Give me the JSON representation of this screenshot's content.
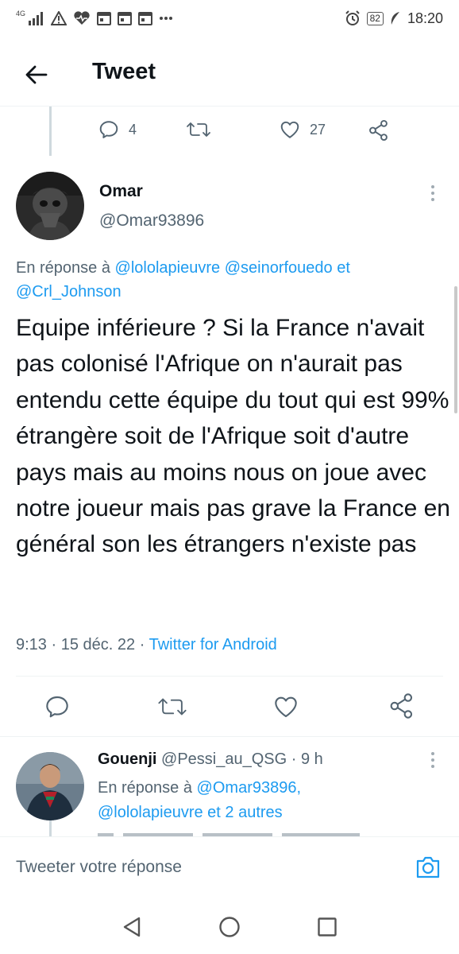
{
  "status_bar": {
    "network": "4G",
    "battery": "82",
    "time": "18:20"
  },
  "header": {
    "title": "Tweet"
  },
  "previous_tweet_actions": {
    "reply_count": "4",
    "retweet_count": "",
    "like_count": "27"
  },
  "main_tweet": {
    "author_name": "Omar",
    "author_handle": "@Omar93896",
    "reply_prefix": "En réponse à",
    "mention_1": "@lololapieuvre",
    "mention_2": "@seinorfouedo",
    "mention_conj": "et",
    "mention_3": "@Crl_Johnson",
    "text": "Equipe inférieure ? Si la France n'avait pas colonisé l'Afrique on n'aurait pas entendu cette équipe du tout qui est 99% étrangère soit de l'Afrique soit d'autre pays mais au moins nous on joue avec notre joueur mais pas grave la France en général son les étrangers n'existe pas",
    "time": "9:13",
    "sep1": "·",
    "date": "15 déc. 22",
    "sep2": "·",
    "source": "Twitter for Android"
  },
  "reply_tweet": {
    "author_name": "Gouenji",
    "author_handle": "@Pessi_au_QSG",
    "sep": "·",
    "age": "9 h",
    "reply_prefix": "En réponse à",
    "mention_1": "@Omar93896,",
    "mention_2": "@lololapieuvre",
    "tail": "et 2 autres"
  },
  "composer": {
    "placeholder": "Tweeter votre réponse"
  },
  "colors": {
    "accent": "#1d9bf0",
    "text": "#0f1419",
    "secondary": "#536471",
    "divider": "#eff3f4"
  },
  "icons": {
    "back": "arrow-left-icon",
    "reply": "comment-icon",
    "retweet": "retweet-icon",
    "like": "heart-icon",
    "share": "share-icon",
    "more": "more-vertical-icon",
    "camera": "camera-icon"
  }
}
